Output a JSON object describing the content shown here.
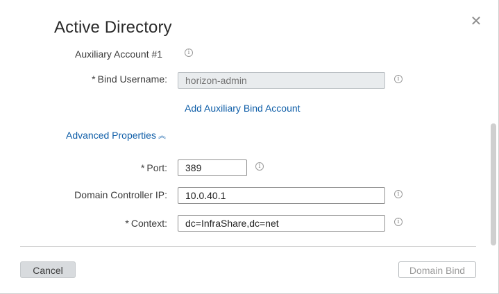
{
  "dialog": {
    "title": "Active Directory",
    "close_icon": "close-icon"
  },
  "aux_section": {
    "label": "Auxiliary Account #1"
  },
  "bind_username": {
    "required_mark": "*",
    "label": "Bind Username:",
    "placeholder": "horizon-admin",
    "disabled": true
  },
  "add_aux_link": "Add Auxiliary Bind Account",
  "advanced": {
    "label": "Advanced Properties",
    "chevron_icon": "chevron-up-double-icon"
  },
  "port": {
    "required_mark": "*",
    "label": "Port:",
    "value": "389"
  },
  "dc_ip": {
    "label": "Domain Controller IP:",
    "value": "10.0.40.1"
  },
  "context": {
    "required_mark": "*",
    "label": "Context:",
    "value": "dc=InfraShare,dc=net"
  },
  "info_glyph": "i",
  "footer": {
    "cancel_label": "Cancel",
    "bind_label": "Domain Bind"
  }
}
